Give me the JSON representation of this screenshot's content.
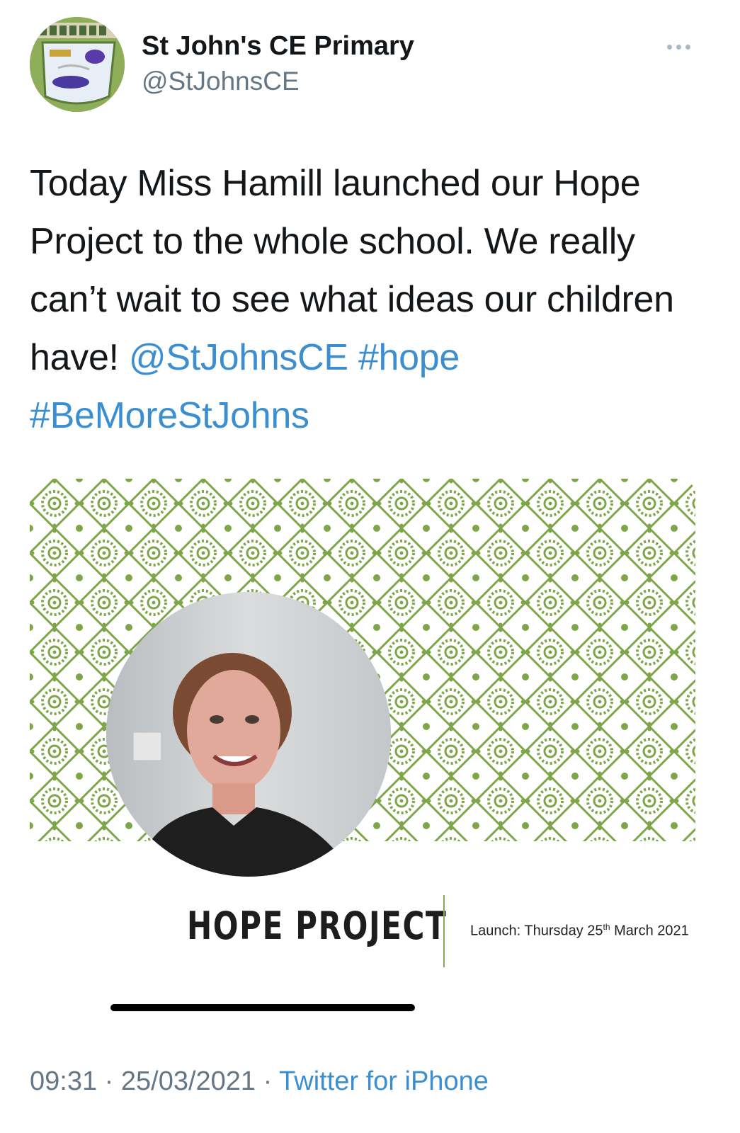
{
  "author": {
    "name": "St John's CE Primary",
    "handle": "@StJohnsCE",
    "avatar_icon": "school-logo-avatar"
  },
  "more_icon": "more-options-icon",
  "tweet": {
    "text_part1": "Today Miss Hamill launched our Hope Project to the whole school. We really can’t wait to see what ideas our children have! ",
    "mention": "@StJohnsCE",
    "hashtag1": "#hope",
    "hashtag2": "#BeMoreStJohns"
  },
  "media": {
    "slide_title": "HOPE PROJECT",
    "launch_label": "Launch: Thursday 25",
    "launch_suffix": "th",
    "launch_rest": " March 2021",
    "pattern_color": "#7ea648",
    "video_progress": 0.46
  },
  "meta": {
    "time": "09:31",
    "separator": " · ",
    "date": "25/03/2021",
    "source": "Twitter for iPhone"
  },
  "colors": {
    "link": "#3b8ed0",
    "secondary_text": "#657786"
  }
}
